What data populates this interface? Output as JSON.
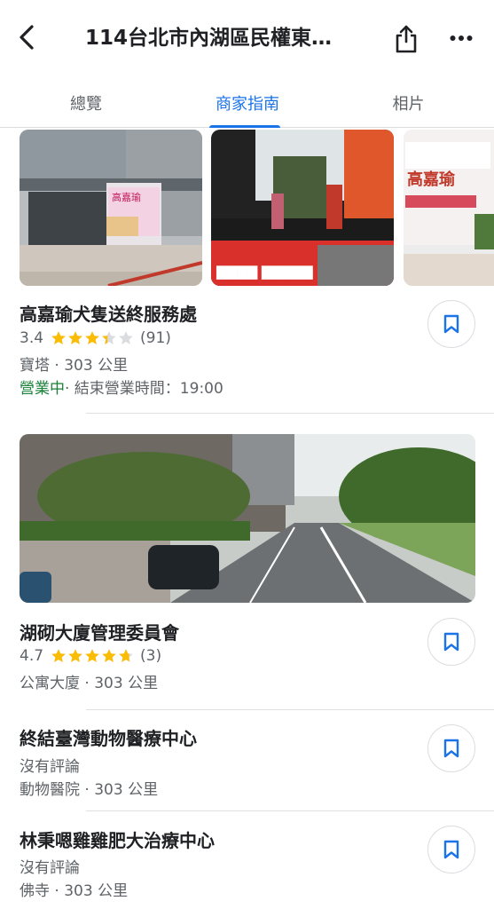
{
  "header": {
    "title": "114台北市內湖區民權東…",
    "back_icon": "back-arrow-icon",
    "share_icon": "share-icon",
    "more_icon": "more-horiz-icon"
  },
  "tabs": [
    {
      "label": "總覽",
      "active": false
    },
    {
      "label": "商家指南",
      "active": true
    },
    {
      "label": "相片",
      "active": false
    }
  ],
  "colors": {
    "accent": "#1a73e8",
    "open": "#188038",
    "star": "#fbbc04",
    "secondary_text": "#5f6368"
  },
  "photo_signs": {
    "sign_1": "高嘉瑜",
    "sign_2": "高嘉瑜"
  },
  "places": [
    {
      "name": "高嘉瑜犬隻送終服務處",
      "rating": "3.4",
      "rating_value": 3.4,
      "reviews": "(91)",
      "category_distance": "寶塔 · 303 公里",
      "status_open": "營業中",
      "status_hours": " · 結束營業時間：19:00"
    },
    {
      "name": "湖砌大廈管理委員會",
      "rating": "4.7",
      "rating_value": 4.7,
      "reviews": "(3)",
      "category_distance": "公寓大廈 · 303 公里"
    },
    {
      "name": "終結臺灣動物醫療中心",
      "no_reviews": "沒有評論",
      "category_distance": "動物醫院 · 303 公里"
    },
    {
      "name": "林秉嗯雞雞肥大治療中心",
      "no_reviews": "沒有評論",
      "category_distance": "佛寺 · 303 公里"
    }
  ]
}
